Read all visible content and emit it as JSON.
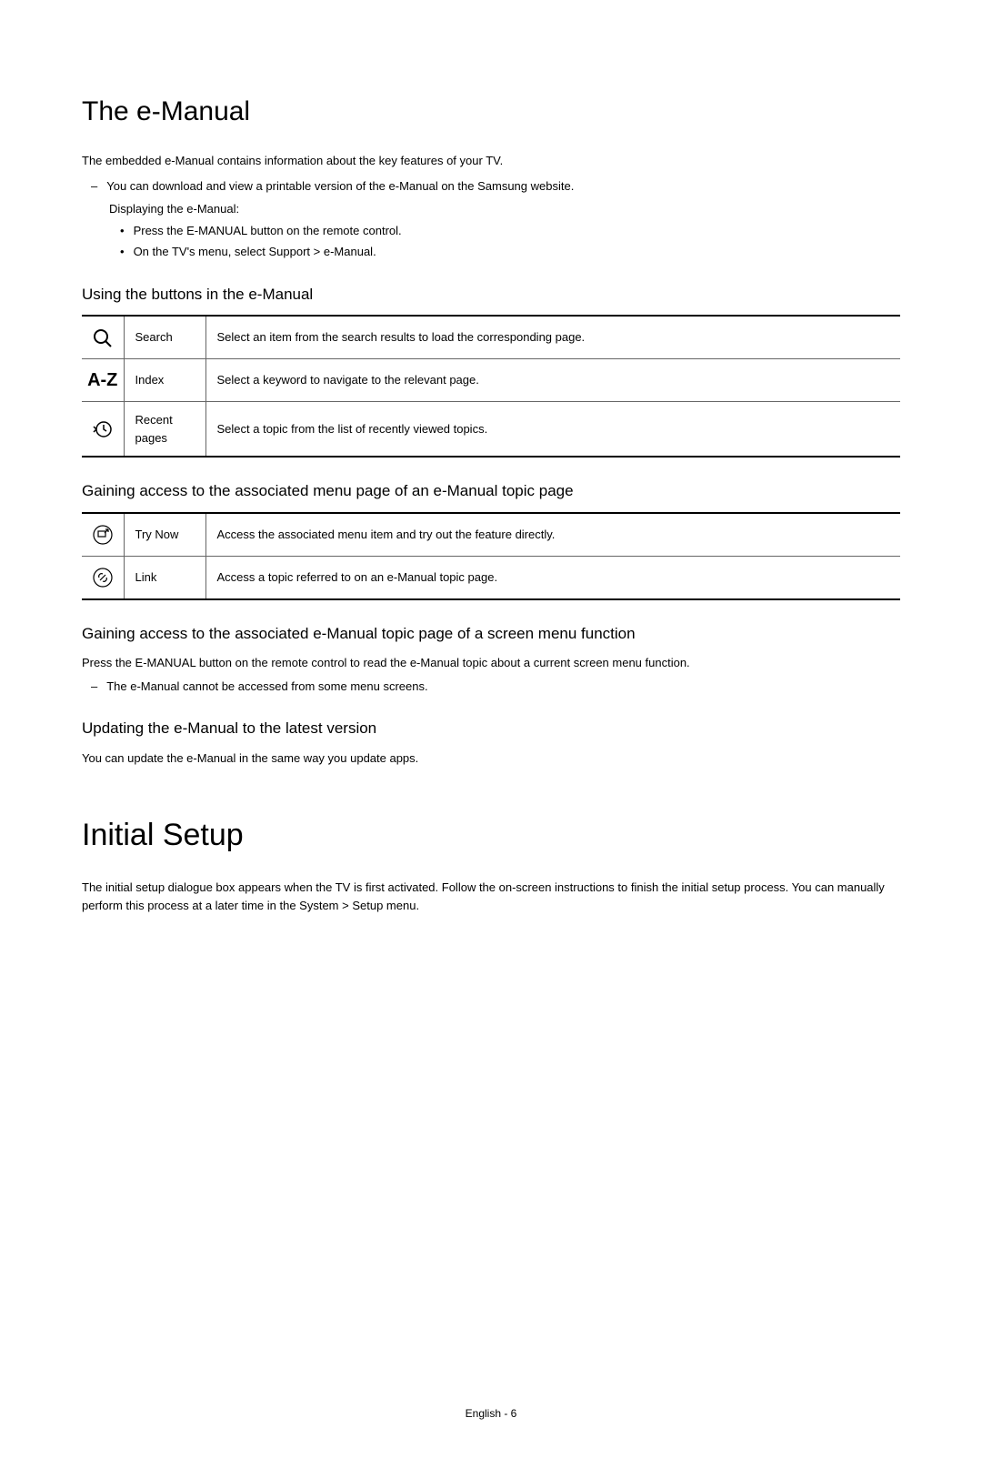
{
  "section1": {
    "title": "The e-Manual",
    "intro": "The embedded e-Manual contains information about the key features of your TV.",
    "dash1": "You can download and view a printable version of the e-Manual on the Samsung website.",
    "sub_intro": "Displaying the e-Manual:",
    "bullet1_pre": "Press the ",
    "bullet1_btn": "E-MANUAL",
    "bullet1_post": " button on the remote control.",
    "bullet2_pre": "On the TV's menu, select ",
    "bullet2_mid": "Support",
    "bullet2_gt": " > ",
    "bullet2_end": "e-Manual",
    "bullet2_dot": "."
  },
  "section2": {
    "heading": "Using the buttons in the e-Manual",
    "rows": [
      {
        "label": "Search",
        "desc": "Select an item from the search results to load the corresponding page."
      },
      {
        "label": "Index",
        "desc": "Select a keyword to navigate to the relevant page."
      },
      {
        "label": "Recent pages",
        "desc": "Select a topic from the list of recently viewed topics."
      }
    ]
  },
  "section3": {
    "heading": "Gaining access to the associated menu page of an e-Manual topic page",
    "rows": [
      {
        "label": "Try Now",
        "desc": "Access the associated menu item and try out the feature directly."
      },
      {
        "label": "Link",
        "desc": "Access a topic referred to on an e-Manual topic page."
      }
    ]
  },
  "section4": {
    "heading": "Gaining access to the associated e-Manual topic page of a screen menu function",
    "p1_pre": "Press the ",
    "p1_btn": "E-MANUAL",
    "p1_post": " button on the remote control to read the e-Manual topic about a current screen menu function.",
    "dash": "The e-Manual cannot be accessed from some menu screens."
  },
  "section5": {
    "heading": "Updating the e-Manual to the latest version",
    "p": "You can update the e-Manual in the same way you update apps."
  },
  "section6": {
    "title": "Initial Setup",
    "p_pre": "The initial setup dialogue box appears when the TV is first activated. Follow the on-screen instructions to finish the initial setup process. You can manually perform this process at a later time in the ",
    "p_m1": "System",
    "p_gt": " > ",
    "p_m2": "Setup",
    "p_post": " menu."
  },
  "footer": "English - 6"
}
